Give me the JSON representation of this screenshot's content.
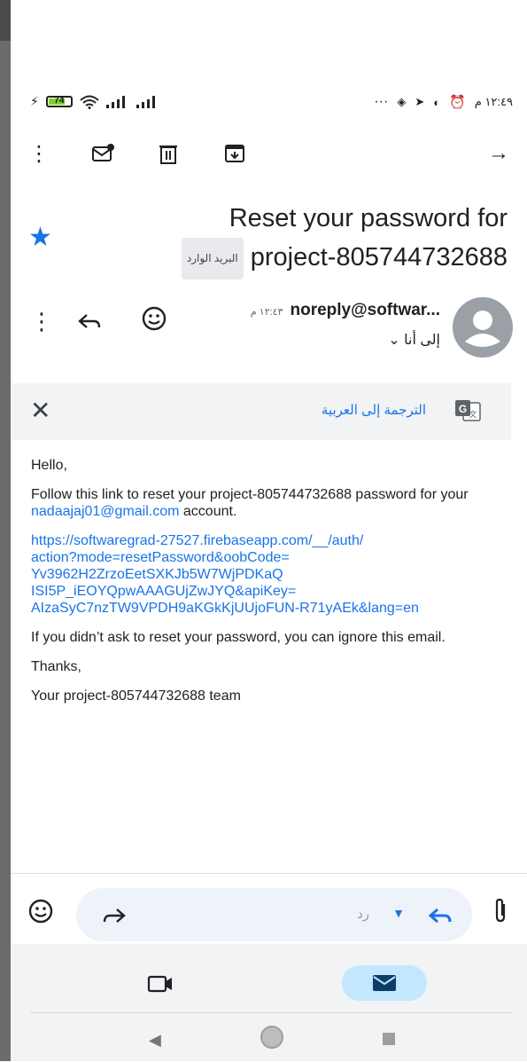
{
  "status_bar": {
    "battery": "74",
    "time": "١٢:٤٩ م",
    "dots": "···"
  },
  "toolbar": {
    "icons": [
      "more-vert-icon",
      "mark-unread-icon",
      "delete-icon",
      "archive-icon",
      "forward-arrow-icon"
    ]
  },
  "email": {
    "subject_line1": "Reset your password for",
    "subject_line2": "project-805744732688",
    "label_chip": "البريد الوارد",
    "sender": "noreply@softwar...",
    "time": "١٢:٤٣ م",
    "to": "إلى أنا"
  },
  "translate": {
    "label": "الترجمة إلى العربية"
  },
  "body": {
    "greeting": "Hello,",
    "p1_before": "Follow this link to reset your project-805744732688 password for your ",
    "p1_email": "nadaajaj01@gmail.com",
    "p1_after": " account.",
    "link": "https://softwaregrad-27527.firebaseapp.com/__/auth/action?mode=resetPassword&oobCode=Yv3962H2ZrzoEetSXKJb5W7WjPDKaQISI5P_iEOYQpwAAAGUjZwJYQ&apiKey=AIzaSyC7nzTW9VPDH9aKGkKjUUjoFUN-R71yAEk&lang=en",
    "link_lines": [
      "https://softwaregrad-27527.firebaseapp.com/__/auth/",
      "action?mode=resetPassword&oobCode=",
      "Yv3962H2ZrzoEetSXKJb5W7WjPDKaQ",
      "ISI5P_iEOYQpwAAAGUjZwJYQ&apiKey=",
      "AIzaSyC7nzTW9VPDH9aKGkKjUUjoFUN-R71yAEk&lang=en"
    ],
    "p3": "If you didn’t ask to reset your password, you can ignore this email.",
    "thanks": "Thanks,",
    "signature": "Your project-805744732688 team"
  },
  "reply_bar": {
    "reply_label": "رد"
  }
}
